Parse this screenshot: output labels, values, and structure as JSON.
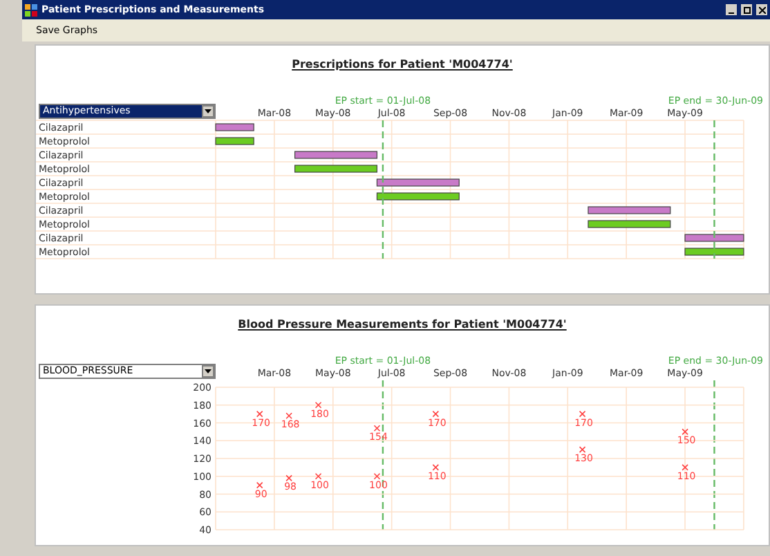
{
  "window": {
    "title": "Patient Prescriptions and Measurements"
  },
  "menu": [
    "Save Graphs"
  ],
  "panels": [
    {
      "kind": "timeline",
      "title": "Prescriptions for Patient 'M004774'",
      "dropdown": {
        "value": "Antihypertensives",
        "focused": true
      },
      "ep_markers": [
        {
          "label": "EP start = 01-Jul-08"
        },
        {
          "label": "EP end = 30-Jun-09"
        }
      ],
      "months": [
        "Mar-08",
        "May-08",
        "Jul-08",
        "Sep-08",
        "Nov-08",
        "Jan-09",
        "Mar-09",
        "May-09"
      ],
      "rows": [
        {
          "drug": "Cilazapril",
          "color": "#c87ac8"
        },
        {
          "drug": "Metoprolol",
          "color": "#6ccc22"
        },
        {
          "drug": "Cilazapril",
          "color": "#c87ac8"
        },
        {
          "drug": "Metoprolol",
          "color": "#6ccc22"
        },
        {
          "drug": "Cilazapril",
          "color": "#c87ac8"
        },
        {
          "drug": "Metoprolol",
          "color": "#6ccc22"
        },
        {
          "drug": "Cilazapril",
          "color": "#c87ac8"
        },
        {
          "drug": "Metoprolol",
          "color": "#6ccc22"
        },
        {
          "drug": "Cilazapril",
          "color": "#c87ac8"
        },
        {
          "drug": "Metoprolol",
          "color": "#6ccc22"
        }
      ]
    },
    {
      "kind": "measurements",
      "title": "Blood Pressure Measurements for Patient 'M004774'",
      "dropdown": {
        "value": "BLOOD_PRESSURE",
        "focused": false
      },
      "ep_markers": [
        {
          "label": "EP start = 01-Jul-08"
        },
        {
          "label": "EP end = 30-Jun-09"
        }
      ],
      "chart_data": {
        "type": "scatter",
        "grid": true,
        "categories": [
          null,
          null,
          null,
          null,
          "Mar-08",
          null,
          null,
          null,
          "May-08",
          null,
          null,
          null,
          "Jul-08",
          null,
          null,
          null,
          "Sep-08",
          null,
          null,
          null,
          "Nov-08",
          null,
          null,
          null,
          "Jan-09",
          null,
          null,
          null,
          "Mar-09",
          null,
          null,
          null,
          "May-09",
          null,
          null,
          null,
          null
        ],
        "ylim": [
          40,
          200
        ],
        "yticks": [
          40,
          60,
          80,
          100,
          120,
          140,
          160,
          180,
          200
        ],
        "series": [
          {
            "color": "#ff4040",
            "values": [
              null,
              null,
              null,
              170,
              null,
              168,
              null,
              180,
              null,
              null,
              null,
              154,
              null,
              null,
              null,
              170,
              null,
              null,
              null,
              null,
              null,
              null,
              null,
              null,
              null,
              170,
              null,
              null,
              null,
              null,
              null,
              null,
              150,
              null,
              null,
              null,
              null
            ]
          },
          {
            "color": "#ff4040",
            "values": [
              null,
              null,
              null,
              90,
              null,
              98,
              null,
              100,
              null,
              null,
              null,
              100,
              null,
              null,
              null,
              110,
              null,
              null,
              null,
              null,
              null,
              null,
              null,
              null,
              null,
              130,
              null,
              null,
              null,
              null,
              null,
              null,
              110,
              null,
              null,
              null,
              null
            ]
          }
        ],
        "data_labels": true
      }
    }
  ]
}
